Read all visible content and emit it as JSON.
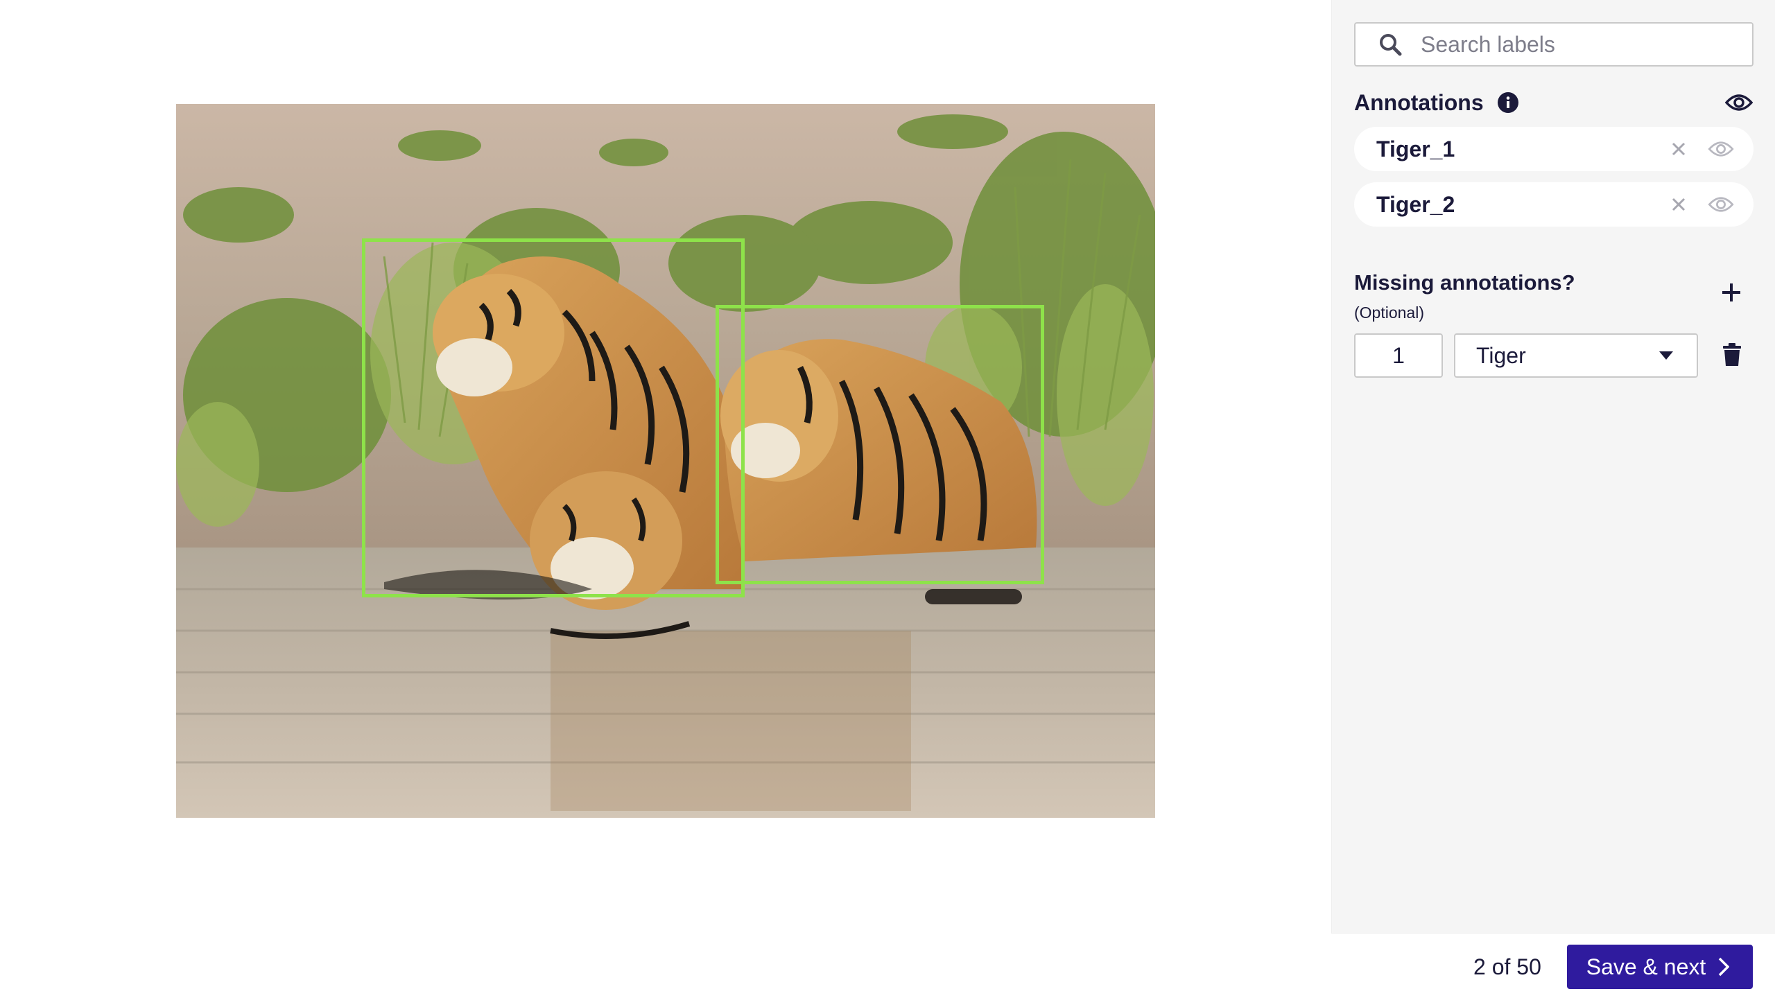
{
  "search": {
    "placeholder": "Search labels",
    "icon": "search-icon"
  },
  "annotations": {
    "title": "Annotations",
    "info_icon": "info-icon",
    "visibility_icon": "eye-icon",
    "items": [
      {
        "label": "Tiger_1",
        "remove_icon": "close-icon",
        "visibility_icon": "eye-icon"
      },
      {
        "label": "Tiger_2",
        "remove_icon": "close-icon",
        "visibility_icon": "eye-icon"
      }
    ]
  },
  "missing": {
    "title": "Missing annotations?",
    "subtitle": "(Optional)",
    "add_icon": "plus-icon",
    "count": "1",
    "label_value": "Tiger",
    "dropdown_icon": "caret-down-icon",
    "delete_icon": "trash-icon"
  },
  "footer": {
    "pager": "2 of 50",
    "save_label": "Save & next",
    "save_icon": "chevron-right-icon"
  },
  "colors": {
    "accent": "#2f1b9e",
    "bbox": "#8ee24a",
    "panel_bg": "#f5f5f5",
    "text": "#1b1a3a"
  }
}
